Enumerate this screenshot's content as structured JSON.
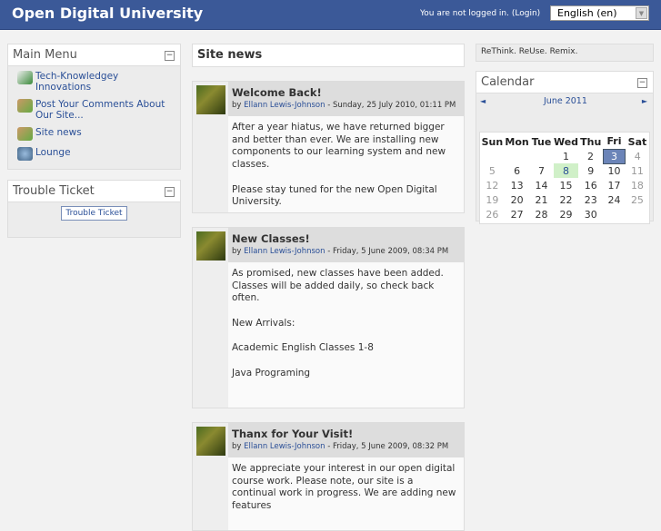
{
  "header": {
    "title": "Open Digital University",
    "login_text": "You are not logged in.",
    "login_link": "(Login)",
    "language": "English (en)"
  },
  "main_menu": {
    "title": "Main Menu",
    "items": [
      {
        "label": "Tech-Knowledgey Innovations",
        "icon": "resource-icon"
      },
      {
        "label": "Post Your Comments About Our Site...",
        "icon": "forum-icon"
      },
      {
        "label": "Site news",
        "icon": "forum-icon"
      },
      {
        "label": "Lounge",
        "icon": "chat-icon"
      }
    ]
  },
  "trouble_ticket": {
    "title": "Trouble Ticket",
    "button": "Trouble Ticket"
  },
  "site_news": {
    "title": "Site news",
    "posts": [
      {
        "title": "Welcome Back!",
        "by": "by",
        "author": "Ellann Lewis-Johnson",
        "date": " - Sunday, 25 July 2010, 01:11 PM",
        "paragraphs": [
          "After a year hiatus, we have returned bigger and better than ever. We are installing new components to our learning system and new classes.",
          "Please stay tuned for the new Open Digital University."
        ]
      },
      {
        "title": "New Classes!",
        "by": "by",
        "author": "Ellann Lewis-Johnson",
        "date": " - Friday, 5 June 2009, 08:34 PM",
        "paragraphs": [
          "As promised, new classes have been added. Classes will be added daily, so check back often.",
          "New Arrivals:",
          "Academic English Classes 1-8",
          "Java Programing"
        ]
      },
      {
        "title": "Thanx for Your Visit!",
        "by": "by",
        "author": "Ellann Lewis-Johnson",
        "date": " - Friday, 5 June 2009, 08:32 PM",
        "paragraphs": [
          "We appreciate your interest in our open digital course work. Please note, our site is a continual work in progress. We are adding new features"
        ]
      }
    ]
  },
  "tagline": "ReThink. ReUse. Remix.",
  "calendar": {
    "title": "Calendar",
    "month": "June 2011",
    "prev": "◄",
    "next": "►",
    "weekdays": [
      "Sun",
      "Mon",
      "Tue",
      "Wed",
      "Thu",
      "Fri",
      "Sat"
    ],
    "weeks": [
      [
        "",
        "",
        "",
        "1",
        "2",
        "3",
        "4"
      ],
      [
        "5",
        "6",
        "7",
        "8",
        "9",
        "10",
        "11"
      ],
      [
        "12",
        "13",
        "14",
        "15",
        "16",
        "17",
        "18"
      ],
      [
        "19",
        "20",
        "21",
        "22",
        "23",
        "24",
        "25"
      ],
      [
        "26",
        "27",
        "28",
        "29",
        "30",
        "",
        ""
      ]
    ],
    "today": "8",
    "event_day": "3",
    "today_color": "#d0f0c8",
    "event_color": "#6b84b8"
  }
}
